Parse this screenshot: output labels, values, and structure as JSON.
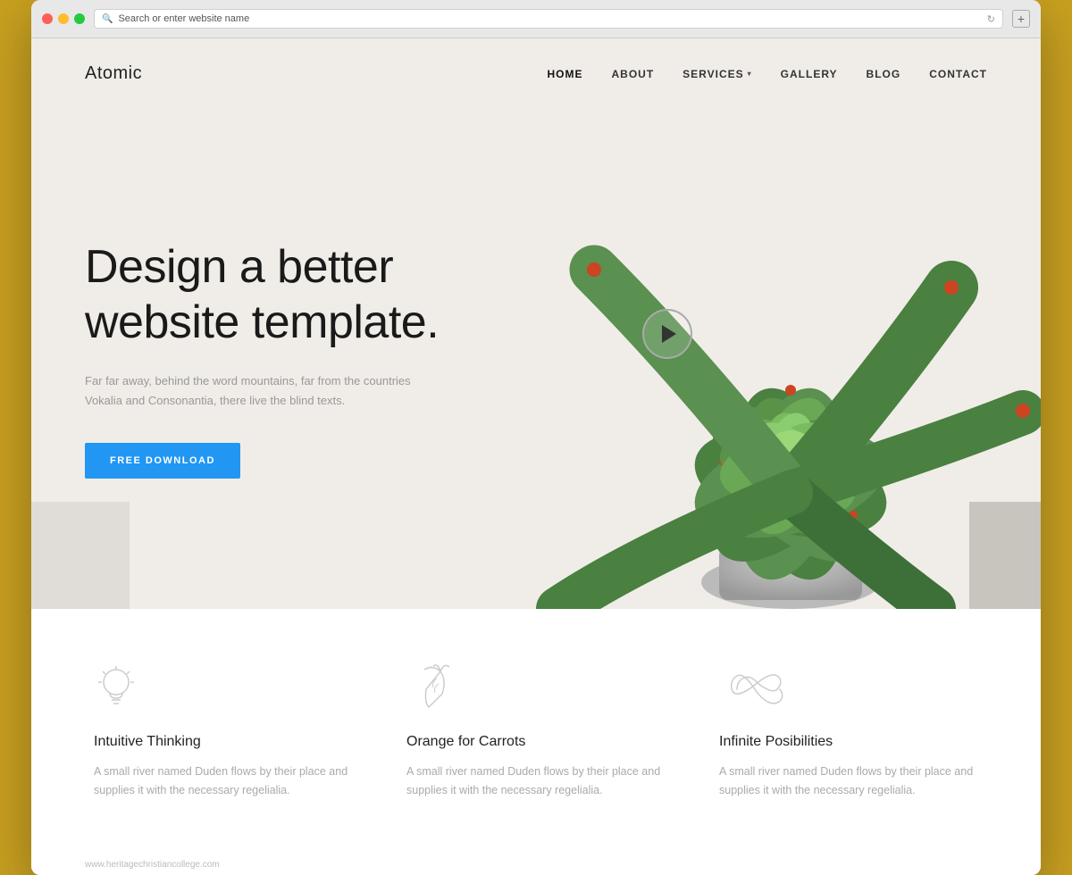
{
  "browser": {
    "address": "Search or enter website name",
    "new_tab_label": "+"
  },
  "nav": {
    "logo": "Atomic",
    "links": [
      {
        "id": "home",
        "label": "HOME",
        "active": true
      },
      {
        "id": "about",
        "label": "ABOUT",
        "active": false
      },
      {
        "id": "services",
        "label": "SERVICES",
        "active": false,
        "has_dropdown": true
      },
      {
        "id": "gallery",
        "label": "GALLERY",
        "active": false
      },
      {
        "id": "blog",
        "label": "BLOG",
        "active": false
      },
      {
        "id": "contact",
        "label": "CONTACT",
        "active": false
      }
    ]
  },
  "hero": {
    "title": "Design a better website template.",
    "subtitle": "Far far away, behind the word mountains, far from the countries Vokalia and Consonantia, there live the blind texts.",
    "cta_label": "FREE DOWNLOAD"
  },
  "features": [
    {
      "id": "intuitive-thinking",
      "title": "Intuitive Thinking",
      "description": "A small river named Duden flows by their place and supplies it with the necessary regelialia.",
      "icon": "lightbulb"
    },
    {
      "id": "orange-for-carrots",
      "title": "Orange for Carrots",
      "description": "A small river named Duden flows by their place and supplies it with the necessary regelialia.",
      "icon": "carrot"
    },
    {
      "id": "infinite-possibilities",
      "title": "Infinite Posibilities",
      "description": "A small river named Duden flows by their place and supplies it with the necessary regelialia.",
      "icon": "infinity"
    }
  ],
  "watermark": {
    "text": "www.heritagechristiancollege.com"
  },
  "colors": {
    "accent": "#2196F3",
    "background": "#f0ede8",
    "text_primary": "#1a1a1a",
    "text_secondary": "#999"
  }
}
